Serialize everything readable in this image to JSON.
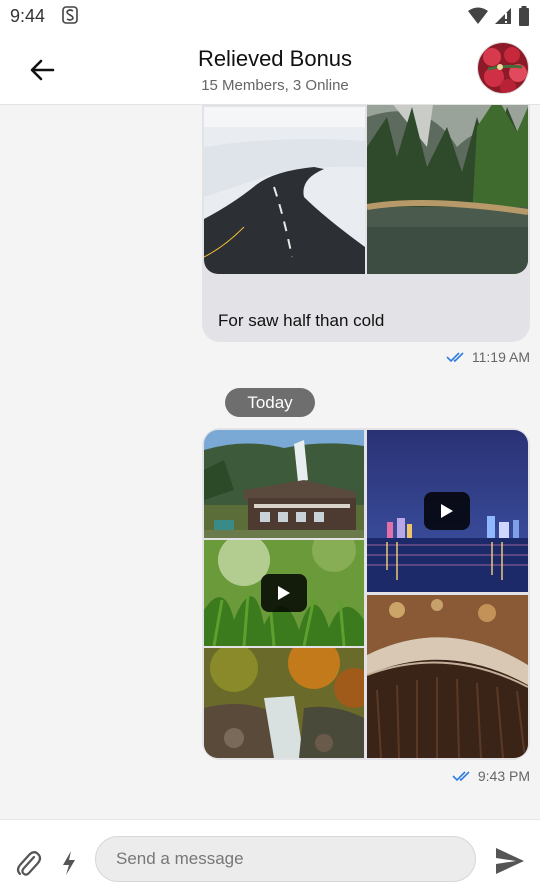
{
  "status_bar": {
    "time": "9:44"
  },
  "header": {
    "title": "Relieved Bonus",
    "subtitle": "15 Members, 3 Online"
  },
  "messages": [
    {
      "caption": "For saw half than cold",
      "time": "11:19 AM",
      "status_icon": "double-check-icon"
    },
    {
      "date_separator": "Today"
    },
    {
      "time": "9:43 PM",
      "status_icon": "double-check-icon"
    }
  ],
  "composer": {
    "placeholder": "Send a message"
  },
  "colors": {
    "accent": "#2f7de1",
    "date_pill": "#6e6e6e",
    "bubble": "#e2e2e7"
  }
}
